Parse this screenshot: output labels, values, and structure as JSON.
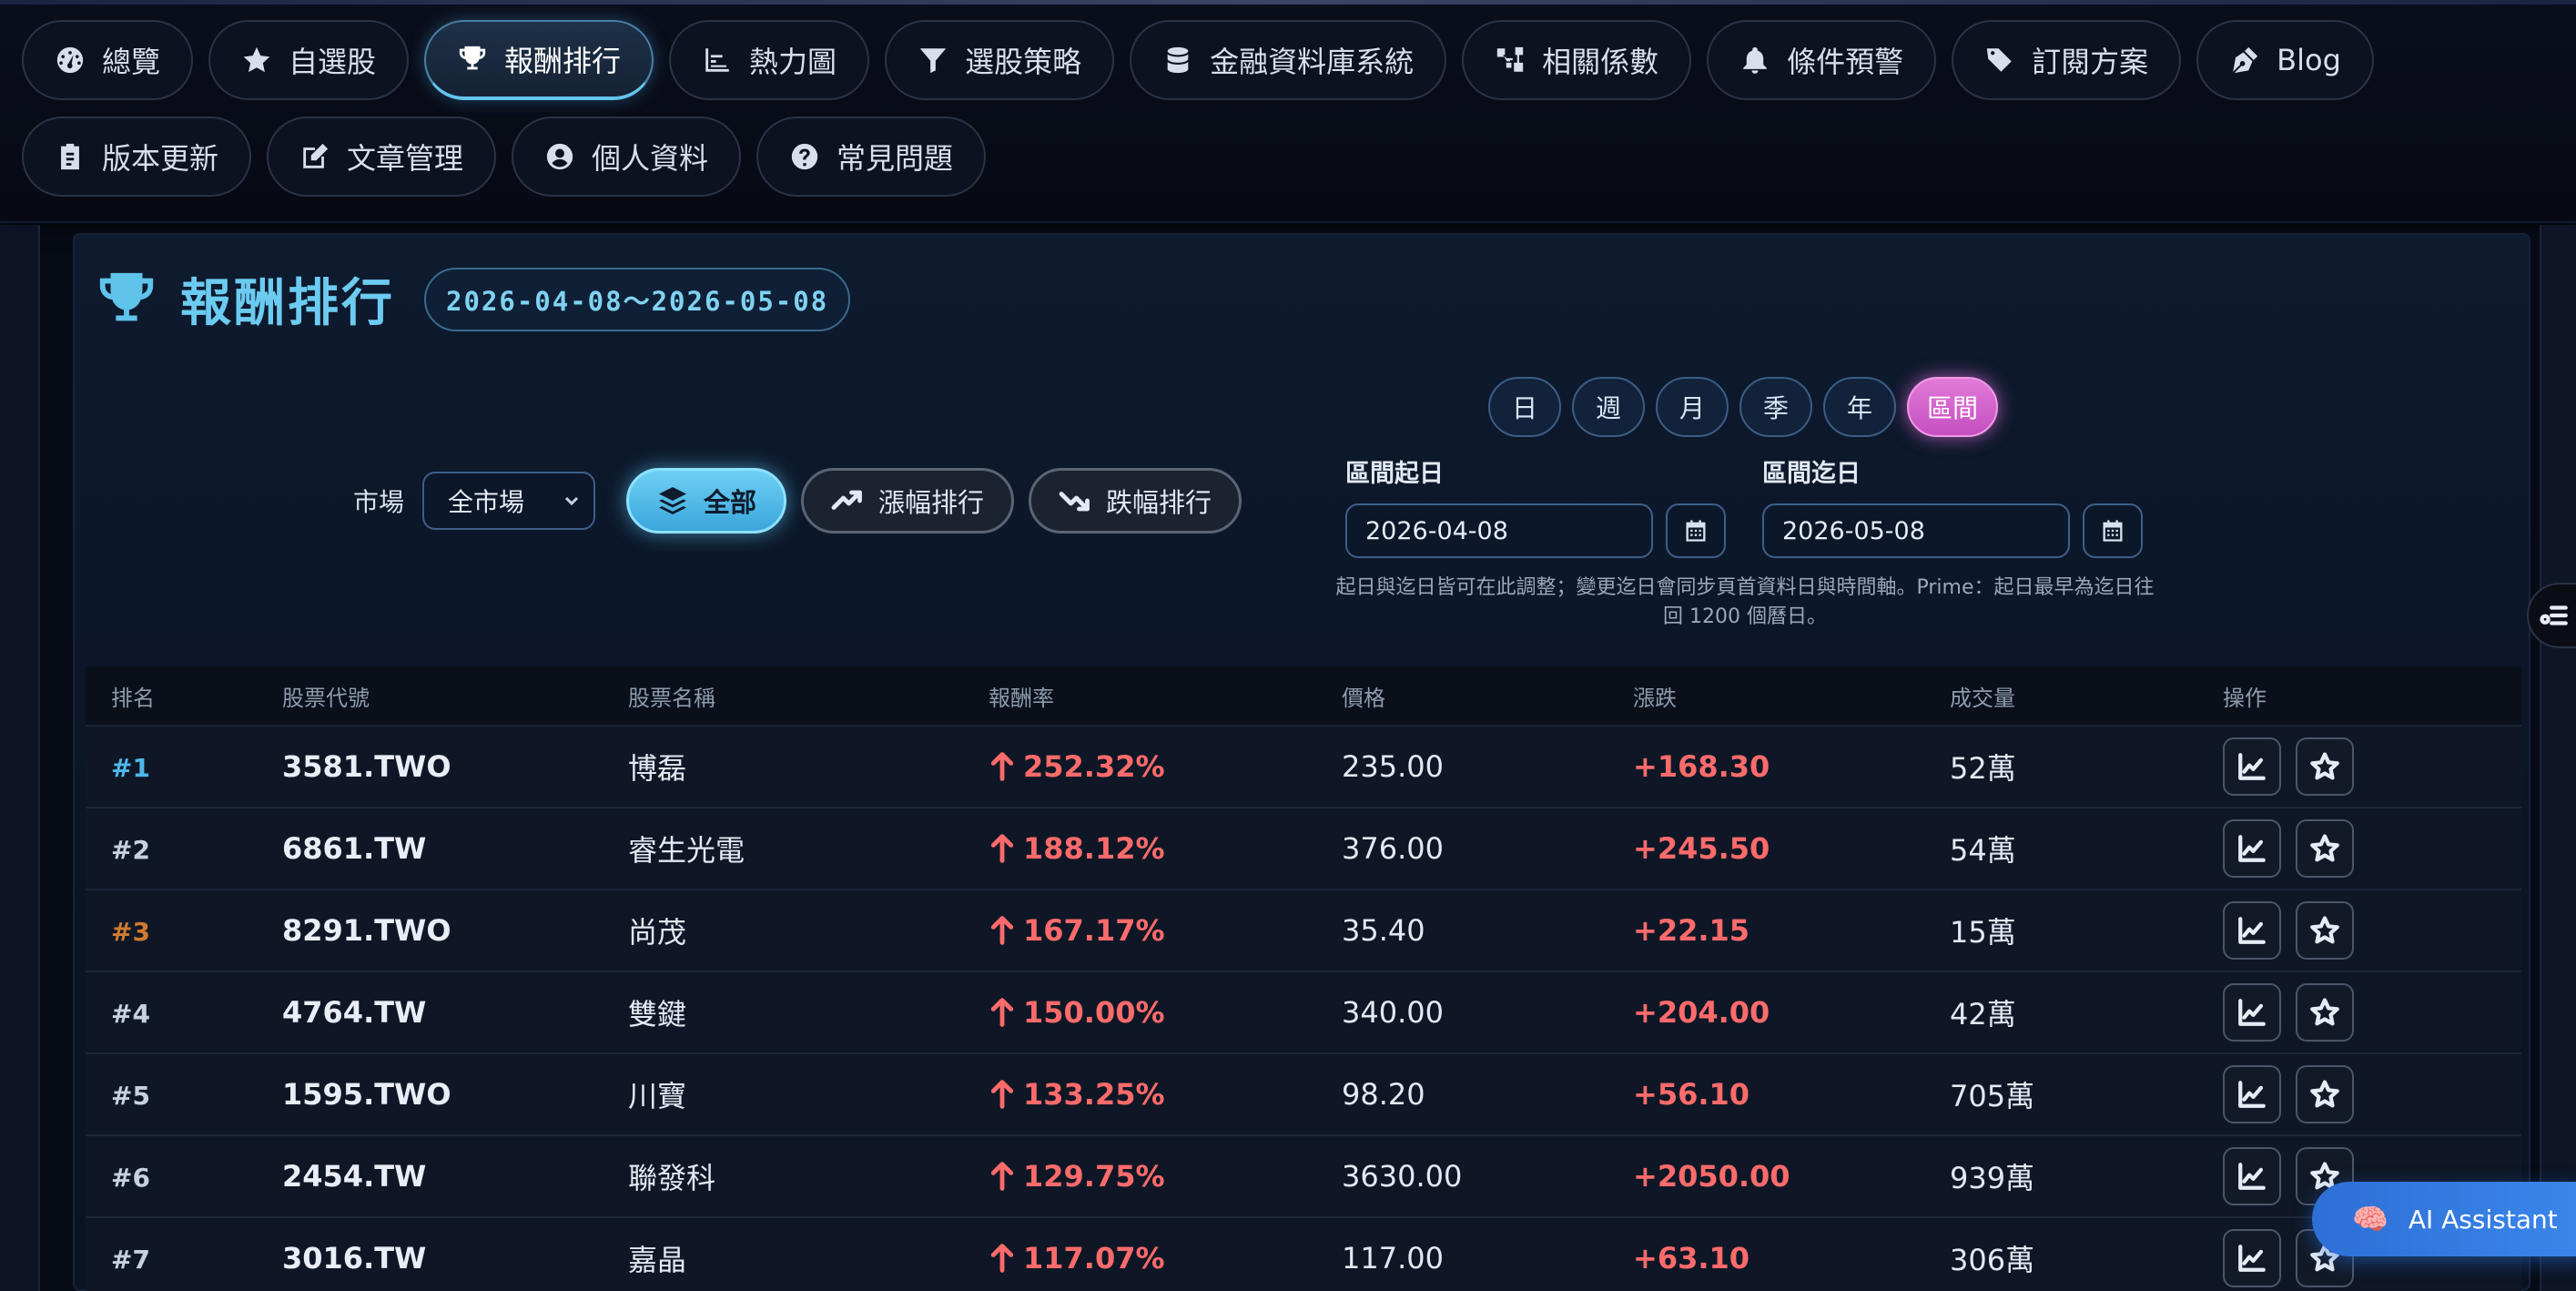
{
  "nav": [
    {
      "label": "總覽",
      "icon": "dashboard-gauge-icon",
      "active": false
    },
    {
      "label": "自選股",
      "icon": "star-icon",
      "active": false
    },
    {
      "label": "報酬排行",
      "icon": "trophy-icon",
      "active": true
    },
    {
      "label": "熱力圖",
      "icon": "bar-chart-icon",
      "active": false
    },
    {
      "label": "選股策略",
      "icon": "filter-icon",
      "active": false
    },
    {
      "label": "金融資料庫系統",
      "icon": "database-icon",
      "active": false
    },
    {
      "label": "相關係數",
      "icon": "network-icon",
      "active": false
    },
    {
      "label": "條件預警",
      "icon": "bell-icon",
      "active": false
    },
    {
      "label": "訂閱方案",
      "icon": "tag-icon",
      "active": false
    },
    {
      "label": "Blog",
      "icon": "pen-nib-icon",
      "active": false
    },
    {
      "label": "版本更新",
      "icon": "clipboard-icon",
      "active": false
    },
    {
      "label": "文章管理",
      "icon": "edit-icon",
      "active": false
    },
    {
      "label": "個人資料",
      "icon": "user-circle-icon",
      "active": false
    },
    {
      "label": "常見問題",
      "icon": "question-circle-icon",
      "active": false
    }
  ],
  "page": {
    "title": "報酬排行",
    "date_range": "2026-04-08～2026-05-08"
  },
  "periods": [
    {
      "label": "日",
      "active": false
    },
    {
      "label": "週",
      "active": false
    },
    {
      "label": "月",
      "active": false
    },
    {
      "label": "季",
      "active": false
    },
    {
      "label": "年",
      "active": false
    },
    {
      "label": "區間",
      "active": true
    }
  ],
  "filters": {
    "market_label": "市場",
    "market_value": "全市場",
    "all_label": "全部",
    "gainers_label": "漲幅排行",
    "losers_label": "跌幅排行"
  },
  "date_range": {
    "start_label": "區間起日",
    "start_value": "2026-04-08",
    "end_label": "區間迄日",
    "end_value": "2026-05-08",
    "hint_line1": "起日與迄日皆可在此調整；變更迄日會同步頁首資料日與時間軸。Prime：起日最早為迄日往",
    "hint_line2": "回 1200 個曆日。"
  },
  "table": {
    "headers": [
      "排名",
      "股票代號",
      "股票名稱",
      "報酬率",
      "價格",
      "漲跌",
      "成交量",
      "操作"
    ],
    "rows": [
      {
        "rank": "#1",
        "code": "3581.TWO",
        "name": "博磊",
        "return": "252.32%",
        "price": "235.00",
        "change": "+168.30",
        "volume": "52萬"
      },
      {
        "rank": "#2",
        "code": "6861.TW",
        "name": "睿生光電",
        "return": "188.12%",
        "price": "376.00",
        "change": "+245.50",
        "volume": "54萬"
      },
      {
        "rank": "#3",
        "code": "8291.TWO",
        "name": "尚茂",
        "return": "167.17%",
        "price": "35.40",
        "change": "+22.15",
        "volume": "15萬"
      },
      {
        "rank": "#4",
        "code": "4764.TW",
        "name": "雙鍵",
        "return": "150.00%",
        "price": "340.00",
        "change": "+204.00",
        "volume": "42萬"
      },
      {
        "rank": "#5",
        "code": "1595.TWO",
        "name": "川寶",
        "return": "133.25%",
        "price": "98.20",
        "change": "+56.10",
        "volume": "705萬"
      },
      {
        "rank": "#6",
        "code": "2454.TW",
        "name": "聯發科",
        "return": "129.75%",
        "price": "3630.00",
        "change": "+2050.00",
        "volume": "939萬"
      },
      {
        "rank": "#7",
        "code": "3016.TW",
        "name": "嘉晶",
        "return": "117.07%",
        "price": "117.00",
        "change": "+63.10",
        "volume": "306萬"
      }
    ]
  },
  "assistant": {
    "label": "AI Assistant",
    "emoji": "🧠"
  },
  "colors": {
    "accent": "#6ccbf0",
    "up": "#ff6b6b",
    "active_period": "#d462cc"
  }
}
